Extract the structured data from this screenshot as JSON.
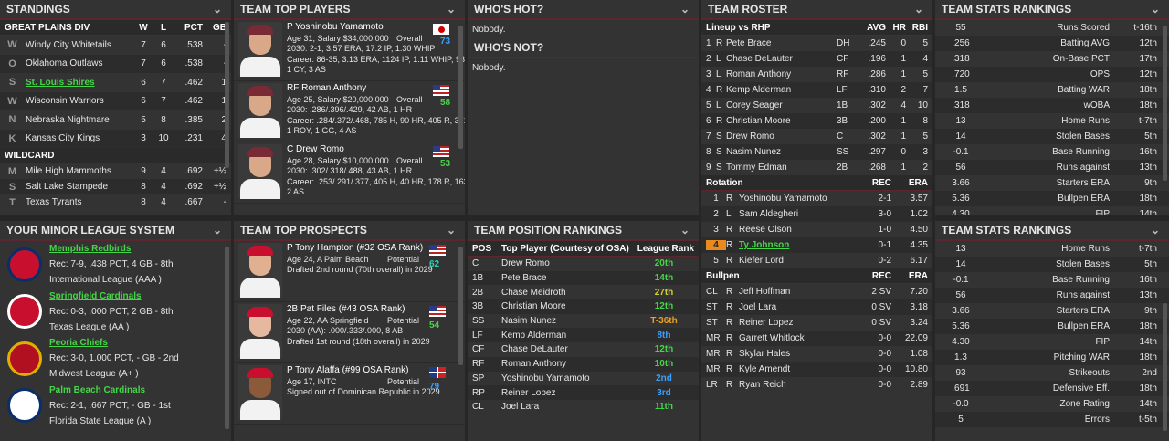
{
  "standings": {
    "title": "STANDINGS",
    "div_header": [
      "GREAT PLAINS DIV",
      "W",
      "L",
      "PCT",
      "GB"
    ],
    "div_rows": [
      [
        "Windy City Whitetails",
        "7",
        "6",
        ".538",
        "-"
      ],
      [
        "Oklahoma Outlaws",
        "7",
        "6",
        ".538",
        "-"
      ],
      [
        "St. Louis Shires",
        "6",
        "7",
        ".462",
        "1"
      ],
      [
        "Wisconsin Warriors",
        "6",
        "7",
        ".462",
        "1"
      ],
      [
        "Nebraska Nightmare",
        "5",
        "8",
        ".385",
        "2"
      ],
      [
        "Kansas City Kings",
        "3",
        "10",
        ".231",
        "4"
      ]
    ],
    "wc_header": "WILDCARD",
    "wc_rows": [
      [
        "Mile High Mammoths",
        "9",
        "4",
        ".692",
        "+½"
      ],
      [
        "Salt Lake Stampede",
        "8",
        "4",
        ".692",
        "+½"
      ],
      [
        "Texas Tyrants",
        "8",
        "4",
        ".667",
        "-"
      ]
    ]
  },
  "top_players": {
    "title": "TEAM TOP PLAYERS",
    "players": [
      {
        "name": "P Yoshinobu Yamamoto",
        "info": "Age 31, Salary $34,000,000",
        "ovr_label": "Overall",
        "ovr": "73",
        "l1": "2030: 2-1, 3.57 ERA, 17.2 IP, 1.30 WHIP",
        "l2": "Career: 86-35, 3.13 ERA, 1124 IP, 1.11 WHIP, 934 K",
        "l3": "1 CY, 3 AS"
      },
      {
        "name": "RF Roman Anthony",
        "info": "Age 25, Salary $20,000,000",
        "ovr_label": "Overall",
        "ovr": "58",
        "l1": "2030: .286/.396/.429, 42 AB, 1 HR",
        "l2": "Career: .284/.372/.468, 785 H, 90 HR, 405 R, 371 RBI",
        "l3": "1 ROY, 1 GG, 4 AS"
      },
      {
        "name": "C Drew Romo",
        "info": "Age 28, Salary $10,000,000",
        "ovr_label": "Overall",
        "ovr": "53",
        "l1": "2030: .302/.318/.488, 43 AB, 1 HR",
        "l2": "Career: .253/.291/.377, 405 H, 40 HR, 178 R, 163 RBI",
        "l3": "2 AS"
      }
    ]
  },
  "whos_hot": {
    "title": "WHO'S HOT?",
    "text": "Nobody.",
    "not_title": "WHO'S NOT?",
    "not_text": "Nobody."
  },
  "roster": {
    "title": "TEAM ROSTER",
    "lineup_header": [
      "Lineup vs RHP",
      "AVG",
      "HR",
      "RBI"
    ],
    "lineup": [
      [
        "1",
        "R",
        "Pete Brace",
        "DH",
        ".245",
        "0",
        "5"
      ],
      [
        "2",
        "L",
        "Chase DeLauter",
        "CF",
        ".196",
        "1",
        "4"
      ],
      [
        "3",
        "L",
        "Roman Anthony",
        "RF",
        ".286",
        "1",
        "5"
      ],
      [
        "4",
        "R",
        "Kemp Alderman",
        "LF",
        ".310",
        "2",
        "7"
      ],
      [
        "5",
        "L",
        "Corey Seager",
        "1B",
        ".302",
        "4",
        "10"
      ],
      [
        "6",
        "R",
        "Christian Moore",
        "3B",
        ".200",
        "1",
        "8"
      ],
      [
        "7",
        "S",
        "Drew Romo",
        "C",
        ".302",
        "1",
        "5"
      ],
      [
        "8",
        "S",
        "Nasim Nunez",
        "SS",
        ".297",
        "0",
        "3"
      ],
      [
        "9",
        "S",
        "Tommy Edman",
        "2B",
        ".268",
        "1",
        "2"
      ]
    ],
    "rot_header": [
      "Rotation",
      "REC",
      "ERA"
    ],
    "rotation": [
      [
        "1",
        "R",
        "Yoshinobu Yamamoto",
        "2-1",
        "3.57"
      ],
      [
        "2",
        "L",
        "Sam Aldegheri",
        "3-0",
        "1.02"
      ],
      [
        "3",
        "R",
        "Reese Olson",
        "1-0",
        "4.50"
      ],
      [
        "4",
        "R",
        "Ty Johnson",
        "0-1",
        "4.35"
      ],
      [
        "5",
        "R",
        "Kiefer Lord",
        "0-2",
        "6.17"
      ]
    ],
    "pen_header": [
      "Bullpen",
      "REC",
      "ERA"
    ],
    "bullpen": [
      [
        "CL",
        "R",
        "Jeff Hoffman",
        "2 SV",
        "7.20"
      ],
      [
        "ST",
        "R",
        "Joel Lara",
        "0 SV",
        "3.18"
      ],
      [
        "ST",
        "R",
        "Reiner Lopez",
        "0 SV",
        "3.24"
      ],
      [
        "MR",
        "R",
        "Garrett Whitlock",
        "0-0",
        "22.09"
      ],
      [
        "MR",
        "R",
        "Skylar Hales",
        "0-0",
        "1.08"
      ],
      [
        "MR",
        "R",
        "Kyle Amendt",
        "0-0",
        "10.80"
      ],
      [
        "LR",
        "R",
        "Ryan Reich",
        "0-0",
        "2.89"
      ]
    ]
  },
  "stats1": {
    "title": "TEAM STATS RANKINGS",
    "rows": [
      [
        "55",
        "Runs Scored",
        "t-16th"
      ],
      [
        ".256",
        "Batting AVG",
        "12th"
      ],
      [
        ".318",
        "On-Base PCT",
        "17th"
      ],
      [
        ".720",
        "OPS",
        "12th"
      ],
      [
        "1.5",
        "Batting WAR",
        "18th"
      ],
      [
        ".318",
        "wOBA",
        "18th"
      ],
      [
        "13",
        "Home Runs",
        "t-7th"
      ],
      [
        "14",
        "Stolen Bases",
        "5th"
      ],
      [
        "-0.1",
        "Base Running",
        "16th"
      ],
      [
        "56",
        "Runs against",
        "13th"
      ],
      [
        "3.66",
        "Starters ERA",
        "9th"
      ],
      [
        "5.36",
        "Bullpen ERA",
        "18th"
      ],
      [
        "4.30",
        "FIP",
        "14th"
      ]
    ]
  },
  "minors": {
    "title": "YOUR MINOR LEAGUE SYSTEM",
    "teams": [
      {
        "name": "Memphis Redbirds",
        "rec": "Rec: 7-9, .438 PCT, 4 GB - 8th",
        "league": "International League (AAA )"
      },
      {
        "name": "Springfield Cardinals",
        "rec": "Rec: 0-3, .000 PCT, 2 GB - 8th",
        "league": "Texas League (AA )"
      },
      {
        "name": "Peoria Chiefs",
        "rec": "Rec: 3-0, 1.000 PCT, - GB - 2nd",
        "league": "Midwest League (A+ )"
      },
      {
        "name": "Palm Beach Cardinals",
        "rec": "Rec: 2-1, .667 PCT, - GB - 1st",
        "league": "Florida State League (A )"
      }
    ]
  },
  "prospects": {
    "title": "TEAM TOP PROSPECTS",
    "players": [
      {
        "name": "P Tony Hampton (#32 OSA Rank)",
        "info": "Age 24, A Palm Beach",
        "pot_label": "Potential",
        "pot": "62",
        "l1": "Drafted 2nd round (70th overall) in 2029"
      },
      {
        "name": "2B Pat Files (#43 OSA Rank)",
        "info": "Age 22, AA Springfield",
        "pot_label": "Potential",
        "pot": "54",
        "l1": "2030 (AA): .000/.333/.000, 8 AB",
        "l2": "Drafted 1st round (18th overall) in 2029"
      },
      {
        "name": "P Tony Alaffa (#99 OSA Rank)",
        "info": "Age 17, INTC",
        "pot_label": "Potential",
        "pot": "79",
        "l1": "Signed out of Dominican Republic in 2029"
      }
    ]
  },
  "positions": {
    "title": "TEAM POSITION RANKINGS",
    "header": [
      "POS",
      "Top Player (Courtesy of OSA)",
      "League Rank"
    ],
    "rows": [
      [
        "C",
        "Drew Romo",
        "20th",
        "g"
      ],
      [
        "1B",
        "Pete Brace",
        "14th",
        "g"
      ],
      [
        "2B",
        "Chase Meidroth",
        "27th",
        "y"
      ],
      [
        "3B",
        "Christian Moore",
        "12th",
        "g"
      ],
      [
        "SS",
        "Nasim Nunez",
        "T-36th",
        "o"
      ],
      [
        "LF",
        "Kemp Alderman",
        "8th",
        "b"
      ],
      [
        "CF",
        "Chase DeLauter",
        "12th",
        "g"
      ],
      [
        "RF",
        "Roman Anthony",
        "10th",
        "g"
      ],
      [
        "SP",
        "Yoshinobu Yamamoto",
        "2nd",
        "b"
      ],
      [
        "RP",
        "Reiner Lopez",
        "3rd",
        "b"
      ],
      [
        "CL",
        "Joel Lara",
        "11th",
        "g"
      ]
    ]
  },
  "stats2": {
    "title": "TEAM STATS RANKINGS",
    "rows": [
      [
        "13",
        "Home Runs",
        "t-7th"
      ],
      [
        "14",
        "Stolen Bases",
        "5th"
      ],
      [
        "-0.1",
        "Base Running",
        "16th"
      ],
      [
        "56",
        "Runs against",
        "13th"
      ],
      [
        "3.66",
        "Starters ERA",
        "9th"
      ],
      [
        "5.36",
        "Bullpen ERA",
        "18th"
      ],
      [
        "4.30",
        "FIP",
        "14th"
      ],
      [
        "1.3",
        "Pitching WAR",
        "18th"
      ],
      [
        "93",
        "Strikeouts",
        "2nd"
      ],
      [
        ".691",
        "Defensive Eff.",
        "18th"
      ],
      [
        "-0.0",
        "Zone Rating",
        "14th"
      ],
      [
        "5",
        "Errors",
        "t-5th"
      ]
    ]
  }
}
